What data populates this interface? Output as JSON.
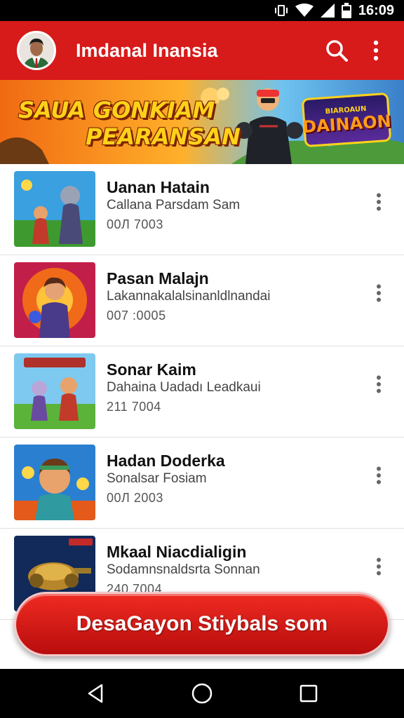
{
  "status_bar": {
    "time": "16:09",
    "icons": [
      "vibrate-icon",
      "wifi-icon",
      "signal-icon",
      "battery-icon"
    ]
  },
  "app_bar": {
    "title": "Imdanal Inansia",
    "icons": [
      "avatar",
      "search-icon",
      "more-vert-icon"
    ]
  },
  "banner": {
    "line1": "SAUA GONKIAM",
    "line2": "PEARANSAN",
    "logo_small": "BIAROAUN",
    "logo_big": "DAINAON"
  },
  "list": {
    "items": [
      {
        "title": "Uanan Hatain",
        "subtitle": "Callana Parsdam Sam",
        "meta": "00Л 7003"
      },
      {
        "title": "Pasan Malajn",
        "subtitle": "Lakannakalalsinanldlnandai",
        "meta": "007 :0005"
      },
      {
        "title": "Sonar Kaim",
        "subtitle": "Dahaina Uadadı Leadkaui",
        "meta": "211 7004"
      },
      {
        "title": "Hadan Doderka",
        "subtitle": "Sonalsar Fosiam",
        "meta": "00Л 2003"
      },
      {
        "title": "Mkaal Niacdialigin",
        "subtitle": "Sodamnsnaldsrta Sonnan",
        "meta": "240 7004"
      }
    ]
  },
  "cta": {
    "label": "DesaGayon Stiybals som"
  },
  "colors": {
    "primary": "#d71a1a",
    "cta": "#e4221a",
    "banner_text": "#ffd21a"
  },
  "nav_bar": {
    "icons": [
      "back-icon",
      "home-icon",
      "recents-icon"
    ]
  }
}
